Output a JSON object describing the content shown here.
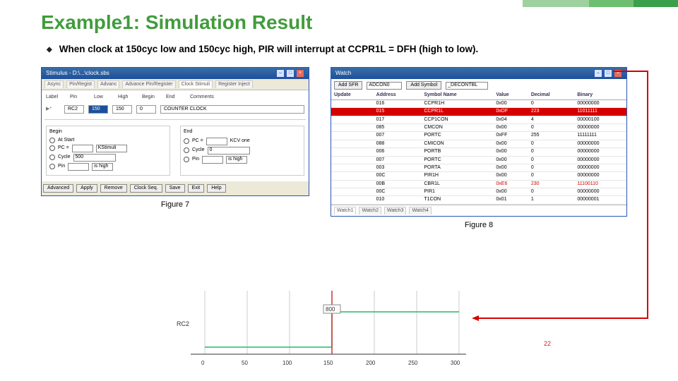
{
  "accent_colors": [
    "#9fd19f",
    "#6fbf73",
    "#3c9f4c"
  ],
  "title": "Example1: Simulation Result",
  "bullet": "When clock at 150cyc low and 150cyc high, PIR will interrupt at CCPR1L = DFH (high to low).",
  "page_number": "22",
  "figure7": {
    "label": "Figure 7"
  },
  "figure8": {
    "label": "Figure 8"
  },
  "stimulus": {
    "title": "Stimulus - D:\\...\\clock.sbs",
    "tabs": [
      "Async",
      "Pin/Regist",
      "Advanc",
      "Advance Pin/Register",
      "Clock Stimuli",
      "Register Inject"
    ],
    "head": {
      "label": "Label",
      "pin": "Pin",
      "low": "Low",
      "high": "High",
      "begin": "Begin",
      "end": "End",
      "comments": "Comments"
    },
    "row": {
      "pin": "RC2",
      "low": "150",
      "high": "150",
      "begin": "0",
      "comments": "COUNTER CLOCK"
    },
    "begin_group": "Begin",
    "end_group": "End",
    "opt_start": "At Start",
    "opt_pc": "PC = ",
    "opt_cycle": "Cycle",
    "opt_pin": "Pin",
    "kstimuli": "KStimuli",
    "cycle_val": "500",
    "pin_high": "is high",
    "pin_val": "0",
    "buttons": [
      "Advanced",
      "Apply",
      "Remove",
      "Clock Seq.",
      "Save",
      "Exit",
      "Help"
    ]
  },
  "watch": {
    "title": "Watch",
    "add_sfr": "Add SFR",
    "sfr_sel": "ADCON0",
    "add_sym": "Add Symbol",
    "sym_sel": "_DECONTBL",
    "cols": {
      "update": "Update",
      "address": "Address",
      "symbol": "Symbol Name",
      "value": "Value",
      "decimal": "Decimal",
      "binary": "Binary"
    },
    "rows": [
      {
        "a": "016",
        "s": "CCPR1H",
        "v": "0x00",
        "d": "0",
        "b": "00000000"
      },
      {
        "a": "015",
        "s": "CCPR1L",
        "v": "0xDF",
        "d": "223",
        "b": "11011111",
        "hl": true
      },
      {
        "a": "017",
        "s": "CCP1CON",
        "v": "0x04",
        "d": "4",
        "b": "00000100"
      },
      {
        "a": "085",
        "s": "CMCON",
        "v": "0x00",
        "d": "0",
        "b": "00000000"
      },
      {
        "a": "007",
        "s": "PORTC",
        "v": "0xFF",
        "d": "255",
        "b": "11111111"
      },
      {
        "a": "088",
        "s": "CMICON",
        "v": "0x00",
        "d": "0",
        "b": "00000000"
      },
      {
        "a": "006",
        "s": "PORTB",
        "v": "0x00",
        "d": "0",
        "b": "00000000"
      },
      {
        "a": "007",
        "s": "PORTC",
        "v": "0x00",
        "d": "0",
        "b": "00000000"
      },
      {
        "a": "003",
        "s": "PORTA",
        "v": "0x00",
        "d": "0",
        "b": "00000000"
      },
      {
        "a": "00C",
        "s": "PIR1H",
        "v": "0x00",
        "d": "0",
        "b": "00000000"
      },
      {
        "a": "00B",
        "s": "CBR1L",
        "v": "0xE6",
        "d": "230",
        "b": "11100110",
        "red": true
      },
      {
        "a": "00C",
        "s": "PIR1",
        "v": "0x00",
        "d": "0",
        "b": "00000000"
      },
      {
        "a": "010",
        "s": "T1CON",
        "v": "0x01",
        "d": "1",
        "b": "00000001"
      }
    ],
    "tabs": [
      "Watch1",
      "Watch2",
      "Watch3",
      "Watch4"
    ]
  },
  "chart_data": {
    "type": "line",
    "title": "",
    "xlabel": "",
    "ylabel": "",
    "y_signals": [
      "RC2"
    ],
    "x": [
      0.0,
      50.0,
      100.0,
      150.0,
      200.0,
      250.0,
      300.0
    ],
    "xlim": [
      0,
      300
    ],
    "ylim": [
      0,
      1
    ],
    "annotations": [
      {
        "x": 150,
        "label": "800"
      }
    ],
    "series": [
      {
        "name": "RC2",
        "type": "digital",
        "period": 300,
        "duty": 0.5,
        "transitions": [
          0,
          150,
          300
        ],
        "values_between": [
          0,
          1,
          0
        ]
      }
    ],
    "cursor_x": 150
  }
}
